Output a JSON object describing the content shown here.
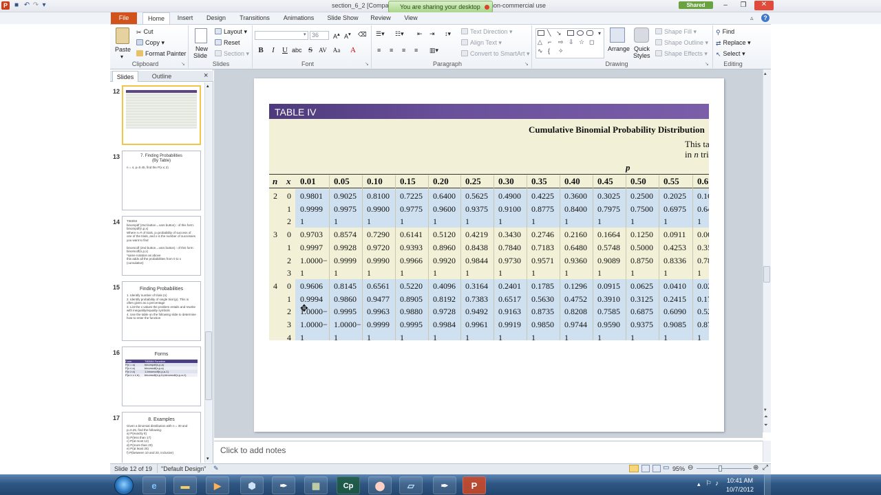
{
  "titlebar": {
    "doc_title_left": "section_6_2 [Compa",
    "doc_title_right": "non-commercial use",
    "share_banner": "You are sharing your desktop",
    "shared_button": "Shared"
  },
  "tabs": [
    "File",
    "Home",
    "Insert",
    "Design",
    "Transitions",
    "Animations",
    "Slide Show",
    "Review",
    "View"
  ],
  "ribbon": {
    "clipboard": {
      "paste": "Paste",
      "cut": "Cut",
      "copy": "Copy",
      "format_painter": "Format Painter",
      "label": "Clipboard"
    },
    "slides": {
      "new_slide": "New",
      "new_slide2": "Slide",
      "layout": "Layout",
      "reset": "Reset",
      "section": "Section",
      "label": "Slides"
    },
    "font": {
      "size": "36",
      "bold": "B",
      "italic": "I",
      "underline": "U",
      "strike": "S",
      "shadow": "abc",
      "label": "Font"
    },
    "paragraph": {
      "text_direction": "Text Direction",
      "align_text": "Align Text",
      "smartart": "Convert to SmartArt",
      "label": "Paragraph"
    },
    "drawing": {
      "arrange": "Arrange",
      "quick_styles": "Quick",
      "quick_styles2": "Styles",
      "shape_fill": "Shape Fill",
      "shape_outline": "Shape Outline",
      "shape_effects": "Shape Effects",
      "label": "Drawing"
    },
    "editing": {
      "find": "Find",
      "replace": "Replace",
      "select": "Select",
      "label": "Editing"
    }
  },
  "panel": {
    "tab_slides": "Slides",
    "tab_outline": "Outline",
    "close": "×",
    "slides": [
      {
        "num": "12",
        "title": "",
        "body": ""
      },
      {
        "num": "13",
        "title": "7.  Finding Probabilities\n(By Table)",
        "body": "n = 4, p=0.45, find the P(x ≤ 2)"
      },
      {
        "num": "14",
        "title": "",
        "body": "TI83/84\nbinompdf (2nd button→vars button) : of this form: binompdf(n,p,x)\nWhere n=# of trials, p=probability of success of one of the trials, and x is the number of successes you want to find\n\nbinomcdf (2nd button→vars button) : of this form: binomcdf(n,p,x)\n*same notation as above\nthis adds all the probabilities from 0 to x (cumulative)"
      },
      {
        "num": "15",
        "title": "Finding Probabilities",
        "body": "1. Identify number of trials (n)\n2. Identify probability of single trial (p). This is often given as a percentage\n3. List the x values the problem entails and rewrite with inequality/equality symbols\n4. Use the table on the following slide to determine how to enter the function"
      },
      {
        "num": "16",
        "title": "Forms",
        "body": ""
      },
      {
        "num": "17",
        "title": "8. Examples",
        "body": "Given a binomial distribution with n = 30 and p=0.25, find the following:\na) P(exactly 8)\nb) P(less than 17)\nc) P(at most 12)\nd) P(more than 20)\ne) P(at least 25)\nf) P(between 10 and 20, inclusive)"
      }
    ],
    "forms_table": {
      "headers": [
        "Form",
        "TI83/84 Function"
      ],
      "rows": [
        [
          "P(x = a)",
          "binompdf(n,p,a)"
        ],
        [
          "P(x ≤ a)",
          "binomcdf(n,p,a)"
        ],
        [
          "P(x ≥ a)",
          "1-binomcdf(n,p,a-1)"
        ],
        [
          "P(a ≤ x ≤ b)",
          "binomcdf(n,p,b)-binomcdf(n,p,a-1)"
        ]
      ]
    }
  },
  "slide": {
    "table_title": "TABLE IV",
    "caption": "Cumulative Binomial Probability Distribution",
    "note_line1": "This ta",
    "note_line2a": "in ",
    "note_line2b": "n",
    "note_line2c": " tri",
    "p_label": "p",
    "col_n": "n",
    "col_x": "x",
    "p_headers": [
      "0.01",
      "0.05",
      "0.10",
      "0.15",
      "0.20",
      "0.25",
      "0.30",
      "0.35",
      "0.40",
      "0.45",
      "0.50",
      "0.55",
      "0.6"
    ],
    "groups": [
      {
        "n": "2",
        "rows": [
          {
            "x": "0",
            "v": [
              "0.9801",
              "0.9025",
              "0.8100",
              "0.7225",
              "0.6400",
              "0.5625",
              "0.4900",
              "0.4225",
              "0.3600",
              "0.3025",
              "0.2500",
              "0.2025",
              "0.16"
            ]
          },
          {
            "x": "1",
            "v": [
              "0.9999",
              "0.9975",
              "0.9900",
              "0.9775",
              "0.9600",
              "0.9375",
              "0.9100",
              "0.8775",
              "0.8400",
              "0.7975",
              "0.7500",
              "0.6975",
              "0.64"
            ]
          },
          {
            "x": "2",
            "v": [
              "1",
              "1",
              "1",
              "1",
              "1",
              "1",
              "1",
              "1",
              "1",
              "1",
              "1",
              "1",
              "1"
            ]
          }
        ]
      },
      {
        "n": "3",
        "rows": [
          {
            "x": "0",
            "v": [
              "0.9703",
              "0.8574",
              "0.7290",
              "0.6141",
              "0.5120",
              "0.4219",
              "0.3430",
              "0.2746",
              "0.2160",
              "0.1664",
              "0.1250",
              "0.0911",
              "0.06"
            ]
          },
          {
            "x": "1",
            "v": [
              "0.9997",
              "0.9928",
              "0.9720",
              "0.9393",
              "0.8960",
              "0.8438",
              "0.7840",
              "0.7183",
              "0.6480",
              "0.5748",
              "0.5000",
              "0.4253",
              "0.35"
            ]
          },
          {
            "x": "2",
            "v": [
              "1.0000−",
              "0.9999",
              "0.9990",
              "0.9966",
              "0.9920",
              "0.9844",
              "0.9730",
              "0.9571",
              "0.9360",
              "0.9089",
              "0.8750",
              "0.8336",
              "0.78"
            ]
          },
          {
            "x": "3",
            "v": [
              "1",
              "1",
              "1",
              "1",
              "1",
              "1",
              "1",
              "1",
              "1",
              "1",
              "1",
              "1",
              "1"
            ]
          }
        ]
      },
      {
        "n": "4",
        "rows": [
          {
            "x": "0",
            "v": [
              "0.9606",
              "0.8145",
              "0.6561",
              "0.5220",
              "0.4096",
              "0.3164",
              "0.2401",
              "0.1785",
              "0.1296",
              "0.0915",
              "0.0625",
              "0.0410",
              "0.02"
            ]
          },
          {
            "x": "1",
            "v": [
              "0.9994",
              "0.9860",
              "0.9477",
              "0.8905",
              "0.8192",
              "0.7383",
              "0.6517",
              "0.5630",
              "0.4752",
              "0.3910",
              "0.3125",
              "0.2415",
              "0.17"
            ]
          },
          {
            "x": "2",
            "v": [
              "1.0000−",
              "0.9995",
              "0.9963",
              "0.9880",
              "0.9728",
              "0.9492",
              "0.9163",
              "0.8735",
              "0.8208",
              "0.7585",
              "0.6875",
              "0.6090",
              "0.52"
            ]
          },
          {
            "x": "3",
            "v": [
              "1.0000−",
              "1.0000−",
              "0.9999",
              "0.9995",
              "0.9984",
              "0.9961",
              "0.9919",
              "0.9850",
              "0.9744",
              "0.9590",
              "0.9375",
              "0.9085",
              "0.87"
            ]
          },
          {
            "x": "4",
            "v": [
              "1",
              "1",
              "1",
              "1",
              "1",
              "1",
              "1",
              "1",
              "1",
              "1",
              "1",
              "1",
              "1"
            ]
          }
        ]
      }
    ]
  },
  "notes_placeholder": "Click to add notes",
  "status": {
    "slide_info": "Slide 12 of 19",
    "theme": "\"Default Design\"",
    "zoom": "95%"
  },
  "clock": {
    "time": "10:41 AM",
    "date": "10/7/2012"
  },
  "colors": {
    "file_tab": "#d2521c",
    "table_header": "#5b4488",
    "table_bg": "#f2f1d8",
    "band": "#cfe0f0",
    "taskbar": "#2f5783"
  }
}
